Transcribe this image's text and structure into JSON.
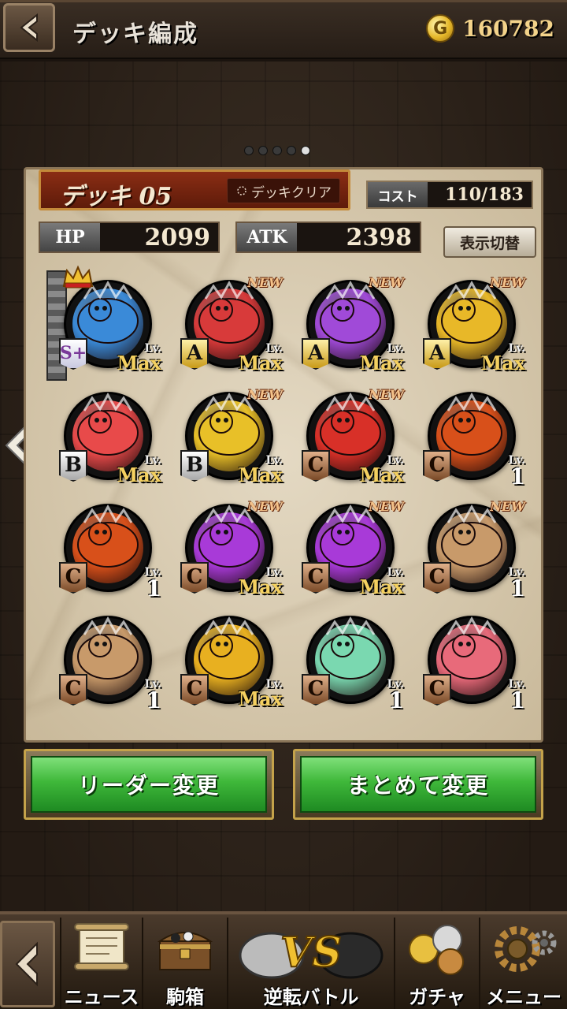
{
  "header": {
    "title": "デッキ編成",
    "coins": "160782",
    "coin_symbol": "G"
  },
  "pager": {
    "total": 5,
    "active": 5
  },
  "deck": {
    "name": "デッキ 05",
    "clear_label": "デッキクリア",
    "cost_label": "コスト",
    "cost_value": "110/183",
    "hp_label": "HP",
    "hp_value": "2099",
    "atk_label": "ATK",
    "atk_value": "2398",
    "toggle_label": "表示切替"
  },
  "units": [
    {
      "rank": "S+",
      "lv": "Max",
      "new": false,
      "color": "#3a8ad8",
      "leader": true
    },
    {
      "rank": "A",
      "lv": "Max",
      "new": true,
      "color": "#d83a3a"
    },
    {
      "rank": "A",
      "lv": "Max",
      "new": true,
      "color": "#a04ad8"
    },
    {
      "rank": "A",
      "lv": "Max",
      "new": true,
      "color": "#e8b828"
    },
    {
      "rank": "B",
      "lv": "Max",
      "new": false,
      "color": "#e84a4a"
    },
    {
      "rank": "B",
      "lv": "Max",
      "new": true,
      "color": "#e8c028"
    },
    {
      "rank": "C",
      "lv": "Max",
      "new": true,
      "color": "#d83028"
    },
    {
      "rank": "C",
      "lv": "1",
      "new": false,
      "color": "#d8501a"
    },
    {
      "rank": "C",
      "lv": "1",
      "new": false,
      "color": "#d8501a"
    },
    {
      "rank": "C",
      "lv": "Max",
      "new": true,
      "color": "#a83ad8"
    },
    {
      "rank": "C",
      "lv": "Max",
      "new": true,
      "color": "#a83ad8"
    },
    {
      "rank": "C",
      "lv": "1",
      "new": true,
      "color": "#c89a6a"
    },
    {
      "rank": "C",
      "lv": "1",
      "new": false,
      "color": "#c89a6a"
    },
    {
      "rank": "C",
      "lv": "Max",
      "new": false,
      "color": "#e8b020"
    },
    {
      "rank": "C",
      "lv": "1",
      "new": false,
      "color": "#7ad8b0"
    },
    {
      "rank": "C",
      "lv": "1",
      "new": false,
      "color": "#e86a7a"
    }
  ],
  "labels": {
    "lv": "Lv.",
    "new": "NEW"
  },
  "actions": {
    "leader_change": "リーダー変更",
    "bulk_change": "まとめて変更"
  },
  "nav": {
    "news": "ニュース",
    "box": "駒箱",
    "battle": "逆転バトル",
    "gacha": "ガチャ",
    "menu": "メニュー",
    "vs_text": "VS"
  }
}
